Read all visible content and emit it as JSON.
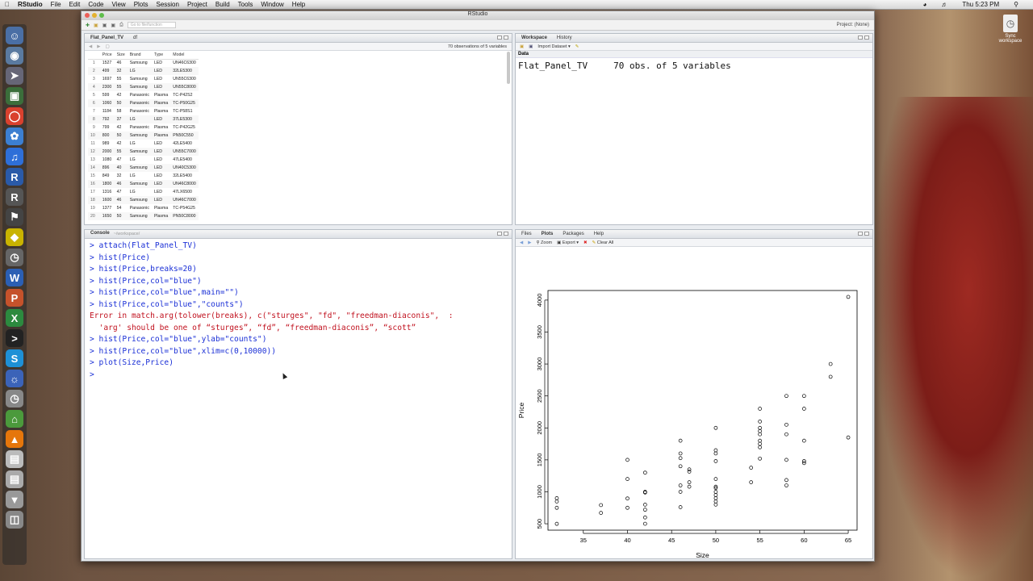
{
  "menubar": {
    "app": "RStudio",
    "items": [
      "File",
      "Edit",
      "Code",
      "View",
      "Plots",
      "Session",
      "Project",
      "Build",
      "Tools",
      "Window",
      "Help"
    ],
    "clock": "Thu 5:23 PM"
  },
  "window": {
    "title": "RStudio",
    "goto_placeholder": "Go to file/function",
    "project": "Project: (None)"
  },
  "desktop_icon": {
    "label1": "Sync",
    "label2": "workspace"
  },
  "source": {
    "tabs": [
      "Flat_Panel_TV",
      "df"
    ],
    "obs": "70 observations of 5 variables",
    "columns": [
      "Price",
      "Size",
      "Brand",
      "Type",
      "Model"
    ],
    "rows": [
      [
        "1",
        "1527",
        "46",
        "Samsung",
        "LED",
        "UN46C6300"
      ],
      [
        "2",
        "499",
        "32",
        "LG",
        "LED",
        "32LE5300"
      ],
      [
        "3",
        "1697",
        "55",
        "Samsung",
        "LED",
        "UN55C6300"
      ],
      [
        "4",
        "2300",
        "55",
        "Samsung",
        "LED",
        "UN55C8000"
      ],
      [
        "5",
        "599",
        "42",
        "Panasonic",
        "Plasma",
        "TC-P42S2"
      ],
      [
        "6",
        "1060",
        "50",
        "Panasonic",
        "Plasma",
        "TC-P50G25"
      ],
      [
        "7",
        "1184",
        "58",
        "Panasonic",
        "Plasma",
        "TC-P58S1"
      ],
      [
        "8",
        "792",
        "37",
        "LG",
        "LED",
        "37LE5300"
      ],
      [
        "9",
        "799",
        "42",
        "Panasonic",
        "Plasma",
        "TC-P42G25"
      ],
      [
        "10",
        "800",
        "50",
        "Samsung",
        "Plasma",
        "PN50C550"
      ],
      [
        "11",
        "989",
        "42",
        "LG",
        "LED",
        "42LE5400"
      ],
      [
        "12",
        "2000",
        "55",
        "Samsung",
        "LED",
        "UN55C7000"
      ],
      [
        "13",
        "1080",
        "47",
        "LG",
        "LED",
        "47LE5400"
      ],
      [
        "14",
        "896",
        "40",
        "Samsung",
        "LED",
        "UN40C5300"
      ],
      [
        "15",
        "849",
        "32",
        "LG",
        "LED",
        "32LE5400"
      ],
      [
        "16",
        "1800",
        "46",
        "Samsung",
        "LED",
        "UN46C8000"
      ],
      [
        "17",
        "1316",
        "47",
        "LG",
        "LED",
        "47LX6500"
      ],
      [
        "18",
        "1600",
        "46",
        "Samsung",
        "LED",
        "UN46C7000"
      ],
      [
        "19",
        "1377",
        "54",
        "Panasonic",
        "Plasma",
        "TC-P54G25"
      ],
      [
        "20",
        "1650",
        "50",
        "Samsung",
        "Plasma",
        "PN50C8000"
      ]
    ]
  },
  "workspace": {
    "tabs": [
      "Workspace",
      "History"
    ],
    "import_label": "Import Dataset",
    "section": "Data",
    "var_name": "Flat_Panel_TV",
    "var_desc": "70 obs. of 5 variables"
  },
  "console": {
    "title": "Console",
    "path": "~/workspace/",
    "lines": [
      {
        "text": "> attach(Flat_Panel_TV)",
        "err": false
      },
      {
        "text": "> hist(Price)",
        "err": false
      },
      {
        "text": "> hist(Price,breaks=20)",
        "err": false
      },
      {
        "text": "> hist(Price,col=\"blue\")",
        "err": false
      },
      {
        "text": "> hist(Price,col=\"blue\",main=\"\")",
        "err": false
      },
      {
        "text": "> hist(Price,col=\"blue\",\"counts\")",
        "err": false
      },
      {
        "text": "Error in match.arg(tolower(breaks), c(\"sturges\", \"fd\", \"freedman-diaconis\",  :",
        "err": true
      },
      {
        "text": "  'arg' should be one of “sturges”, “fd”, “freedman-diaconis”, “scott”",
        "err": true
      },
      {
        "text": "> hist(Price,col=\"blue\",ylab=\"counts\")",
        "err": false
      },
      {
        "text": "> hist(Price,col=\"blue\",xlim=c(0,10000))",
        "err": false
      },
      {
        "text": "> plot(Size,Price)",
        "err": false
      },
      {
        "text": ">",
        "err": false
      }
    ]
  },
  "plots_pane": {
    "tabs": [
      "Files",
      "Plots",
      "Packages",
      "Help"
    ],
    "zoom": "Zoom",
    "export": "Export",
    "clear": "Clear All"
  },
  "chart_data": {
    "type": "scatter",
    "title": "",
    "xlabel": "Size",
    "ylabel": "Price",
    "xlim": [
      31,
      66
    ],
    "ylim": [
      400,
      4150
    ],
    "xticks": [
      35,
      40,
      45,
      50,
      55,
      60,
      65
    ],
    "yticks": [
      500,
      1000,
      1500,
      2000,
      2500,
      3000,
      3500,
      4000
    ],
    "points": [
      [
        32,
        499
      ],
      [
        32,
        849
      ],
      [
        32,
        900
      ],
      [
        32,
        750
      ],
      [
        37,
        792
      ],
      [
        37,
        670
      ],
      [
        40,
        896
      ],
      [
        40,
        1200
      ],
      [
        40,
        1500
      ],
      [
        40,
        750
      ],
      [
        42,
        599
      ],
      [
        42,
        799
      ],
      [
        42,
        989
      ],
      [
        42,
        1000
      ],
      [
        42,
        1300
      ],
      [
        42,
        720
      ],
      [
        42,
        500
      ],
      [
        46,
        1527
      ],
      [
        46,
        1800
      ],
      [
        46,
        1600
      ],
      [
        46,
        1000
      ],
      [
        46,
        1100
      ],
      [
        46,
        760
      ],
      [
        46,
        1400
      ],
      [
        47,
        1080
      ],
      [
        47,
        1316
      ],
      [
        47,
        1350
      ],
      [
        47,
        1150
      ],
      [
        50,
        1060
      ],
      [
        50,
        800
      ],
      [
        50,
        1650
      ],
      [
        50,
        2000
      ],
      [
        50,
        900
      ],
      [
        50,
        950
      ],
      [
        50,
        1000
      ],
      [
        50,
        1200
      ],
      [
        50,
        1600
      ],
      [
        50,
        1480
      ],
      [
        50,
        850
      ],
      [
        50,
        1080
      ],
      [
        54,
        1377
      ],
      [
        54,
        1150
      ],
      [
        55,
        1697
      ],
      [
        55,
        2300
      ],
      [
        55,
        2000
      ],
      [
        55,
        1800
      ],
      [
        55,
        1900
      ],
      [
        55,
        2100
      ],
      [
        55,
        1750
      ],
      [
        55,
        1950
      ],
      [
        55,
        1520
      ],
      [
        58,
        1184
      ],
      [
        58,
        1100
      ],
      [
        58,
        1500
      ],
      [
        58,
        2500
      ],
      [
        58,
        2050
      ],
      [
        58,
        1900
      ],
      [
        60,
        2500
      ],
      [
        60,
        2300
      ],
      [
        60,
        1800
      ],
      [
        60,
        1450
      ],
      [
        60,
        1480
      ],
      [
        63,
        3000
      ],
      [
        63,
        2800
      ],
      [
        65,
        4050
      ],
      [
        65,
        1850
      ]
    ]
  }
}
